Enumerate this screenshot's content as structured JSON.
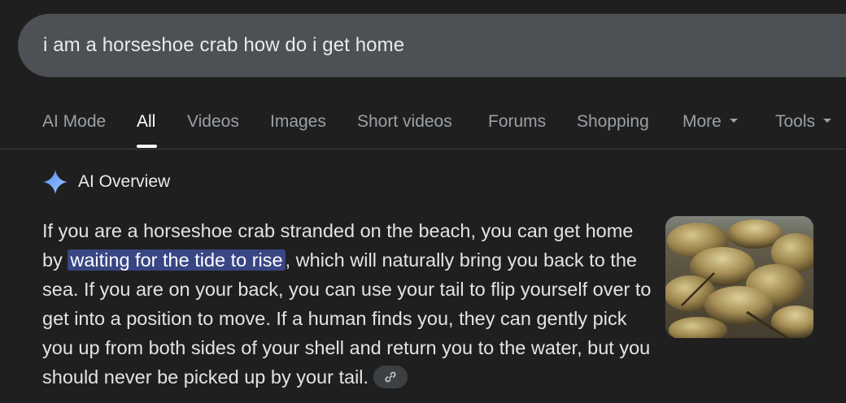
{
  "search": {
    "query": "i am a horseshoe crab how do i get home"
  },
  "tabs": [
    {
      "label": "AI Mode",
      "active": false
    },
    {
      "label": "All",
      "active": true
    },
    {
      "label": "Videos",
      "active": false
    },
    {
      "label": "Images",
      "active": false
    },
    {
      "label": "Short videos",
      "active": false
    },
    {
      "label": "Forums",
      "active": false
    },
    {
      "label": "Shopping",
      "active": false
    },
    {
      "label": "More",
      "active": false,
      "has_dropdown": true
    },
    {
      "label": "Tools",
      "active": false,
      "has_dropdown": true
    }
  ],
  "ai_overview": {
    "title": "AI Overview",
    "icon": "sparkle-icon",
    "text_before": "If you are a horseshoe crab stranded on the beach, you can get home by ",
    "highlighted": "waiting for the tide to rise",
    "text_after": ", which will naturally bring you back to the sea. If you are on your back, you can use your tail to flip yourself over to get into a position to move. If a human finds you, they can gently pick you up from both sides of your shell and return you to the water, but you should never be picked up by your tail.",
    "link_icon": "link-icon",
    "thumbnail_subject": "horseshoe-crabs"
  },
  "colors": {
    "background": "#1f1f1f",
    "search_bar": "#4d5156",
    "highlight": "#394684",
    "sparkle_blue": "#4285f4"
  }
}
